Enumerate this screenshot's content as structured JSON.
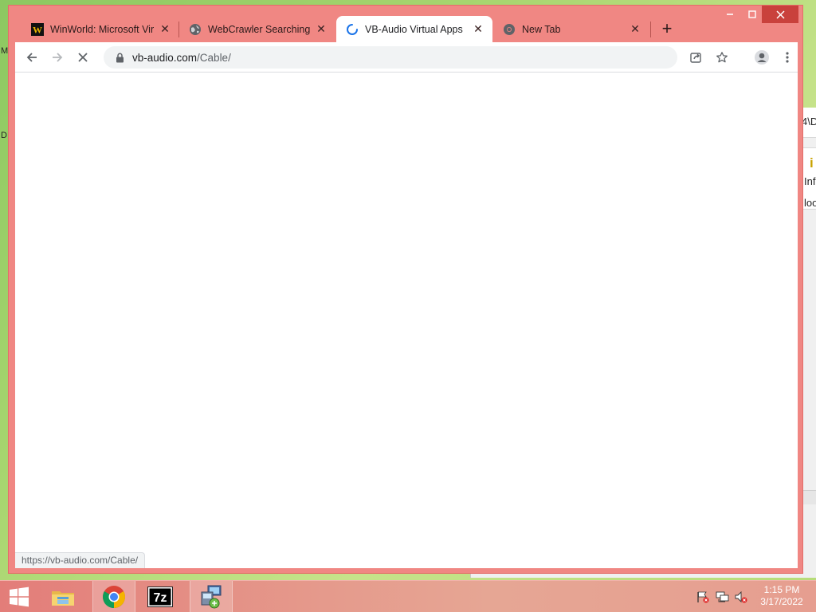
{
  "desktop": {
    "left_fragments": [
      "M",
      "D"
    ],
    "background_window_fragments": [
      "4\\D",
      "i",
      "Inf",
      "loo"
    ]
  },
  "browser": {
    "tabs": [
      {
        "title": "WinWorld: Microsoft Virt",
        "favicon": "winworld-icon",
        "active": false
      },
      {
        "title": "WebCrawler Searching",
        "favicon": "globe-icon",
        "active": false
      },
      {
        "title": "VB-Audio Virtual Apps",
        "favicon": "loading-spinner-icon",
        "active": true
      },
      {
        "title": "New Tab",
        "favicon": "chrome-icon",
        "active": false
      }
    ],
    "new_tab_symbol": "+",
    "address": {
      "domain": "vb-audio.com",
      "path": "/Cable/"
    },
    "status_url": "https://vb-audio.com/Cable/",
    "frame_color": "#f08783"
  },
  "taskbar": {
    "apps": [
      "windows-start-icon",
      "file-explorer-icon",
      "chrome-icon",
      "7zip-icon",
      "network-setup-icon"
    ],
    "tray": [
      "action-center-flag-icon",
      "network-icon",
      "volume-muted-icon"
    ],
    "time": "1:15 PM",
    "date": "3/17/2022"
  }
}
